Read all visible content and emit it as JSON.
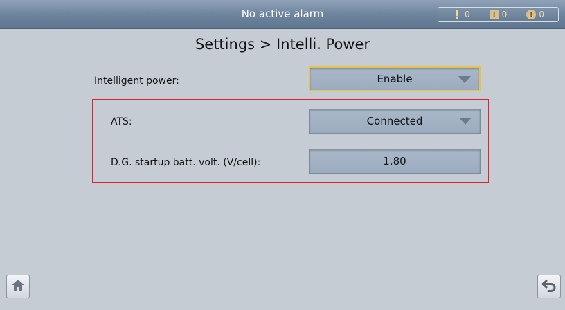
{
  "header": {
    "alarm_status": "No active alarm",
    "counters": [
      {
        "icon": "alarm-bell-icon",
        "count": "0"
      },
      {
        "icon": "warning-exclamation-icon",
        "count": "0"
      },
      {
        "icon": "info-circle-icon",
        "count": "0"
      }
    ]
  },
  "page": {
    "title": "Settings > Intelli. Power"
  },
  "settings": {
    "intelligent_power": {
      "label": "Intelligent power:",
      "value": "Enable"
    },
    "ats": {
      "label": "ATS:",
      "value": "Connected"
    },
    "dg_startup_volt": {
      "label": "D.G. startup batt. volt. (V/cell):",
      "value": "1.80"
    }
  },
  "colors": {
    "highlight_border": "#e0202a",
    "focus_border": "#e6c24a",
    "header_bg": "#6f859e",
    "page_bg": "#c6ccd3"
  },
  "footer": {
    "home_icon": "home-icon",
    "back_icon": "back-arrow-icon"
  }
}
